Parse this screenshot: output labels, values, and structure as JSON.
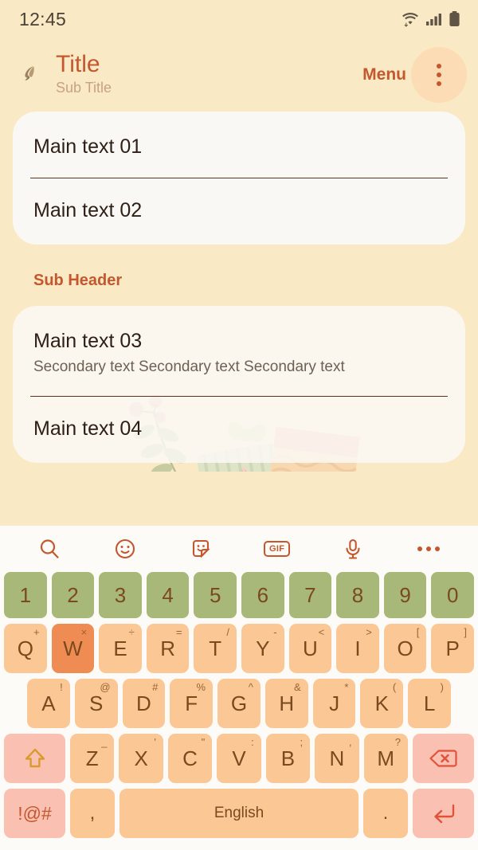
{
  "status_bar": {
    "time": "12:45",
    "icons": [
      "wifi-icon",
      "cellular-signal-icon",
      "battery-icon"
    ]
  },
  "app_bar": {
    "back_icon": "back-arrow-icon",
    "title": "Title",
    "subtitle": "Sub Title",
    "menu_label": "Menu",
    "overflow_icon": "more-vertical-icon"
  },
  "content": {
    "card_one": {
      "rows": [
        {
          "main": "Main text 01"
        },
        {
          "main": "Main text 02"
        }
      ]
    },
    "sub_header": "Sub Header",
    "card_two": {
      "rows": [
        {
          "main": "Main text 03",
          "secondary": "Secondary text Secondary text Secondary text"
        },
        {
          "main": "Main text 04"
        }
      ]
    }
  },
  "keyboard": {
    "toolbar": [
      {
        "name": "search-icon",
        "label": "Search"
      },
      {
        "name": "emoji-icon",
        "label": "Emoji"
      },
      {
        "name": "sticker-icon",
        "label": "Sticker"
      },
      {
        "name": "gif-icon",
        "label": "GIF"
      },
      {
        "name": "microphone-icon",
        "label": "Voice input"
      },
      {
        "name": "more-horizontal-icon",
        "label": "More"
      }
    ],
    "rows": {
      "numbers": [
        {
          "key": "1"
        },
        {
          "key": "2"
        },
        {
          "key": "3"
        },
        {
          "key": "4"
        },
        {
          "key": "5"
        },
        {
          "key": "6"
        },
        {
          "key": "7"
        },
        {
          "key": "8"
        },
        {
          "key": "9"
        },
        {
          "key": "0"
        }
      ],
      "qwerty": [
        {
          "key": "Q",
          "sub": "+"
        },
        {
          "key": "W",
          "sub": "×",
          "pressed": true
        },
        {
          "key": "E",
          "sub": "÷"
        },
        {
          "key": "R",
          "sub": "="
        },
        {
          "key": "T",
          "sub": "/"
        },
        {
          "key": "Y",
          "sub": "-"
        },
        {
          "key": "U",
          "sub": "<"
        },
        {
          "key": "I",
          "sub": ">"
        },
        {
          "key": "O",
          "sub": "["
        },
        {
          "key": "P",
          "sub": "]"
        }
      ],
      "asdf": [
        {
          "key": "A",
          "sub": "!"
        },
        {
          "key": "S",
          "sub": "@"
        },
        {
          "key": "D",
          "sub": "#"
        },
        {
          "key": "F",
          "sub": "%"
        },
        {
          "key": "G",
          "sub": "^"
        },
        {
          "key": "H",
          "sub": "&"
        },
        {
          "key": "J",
          "sub": "*"
        },
        {
          "key": "K",
          "sub": "("
        },
        {
          "key": "L",
          "sub": ")"
        }
      ],
      "zxcv": [
        {
          "key": "Z",
          "sub": "_"
        },
        {
          "key": "X",
          "sub": "'"
        },
        {
          "key": "C",
          "sub": "\""
        },
        {
          "key": "V",
          "sub": ":"
        },
        {
          "key": "B",
          "sub": ";"
        },
        {
          "key": "N",
          "sub": ","
        },
        {
          "key": "M",
          "sub": "?"
        }
      ],
      "bottom": {
        "symbols_label": "!@#",
        "comma": ",",
        "space_label": "English",
        "period": "."
      }
    },
    "shift_icon": "shift-arrow-icon",
    "backspace_icon": "backspace-icon",
    "enter_icon": "enter-return-icon"
  },
  "colors": {
    "page_background": "#fae9c5",
    "accent": "#c4572e",
    "card": "#faf8f4",
    "number_key": "#a8b878",
    "letter_key": "#fbc795",
    "pressed_key": "#ef8c53",
    "special_key": "#fac1b2",
    "keyboard_background": "#fdfbf7"
  }
}
